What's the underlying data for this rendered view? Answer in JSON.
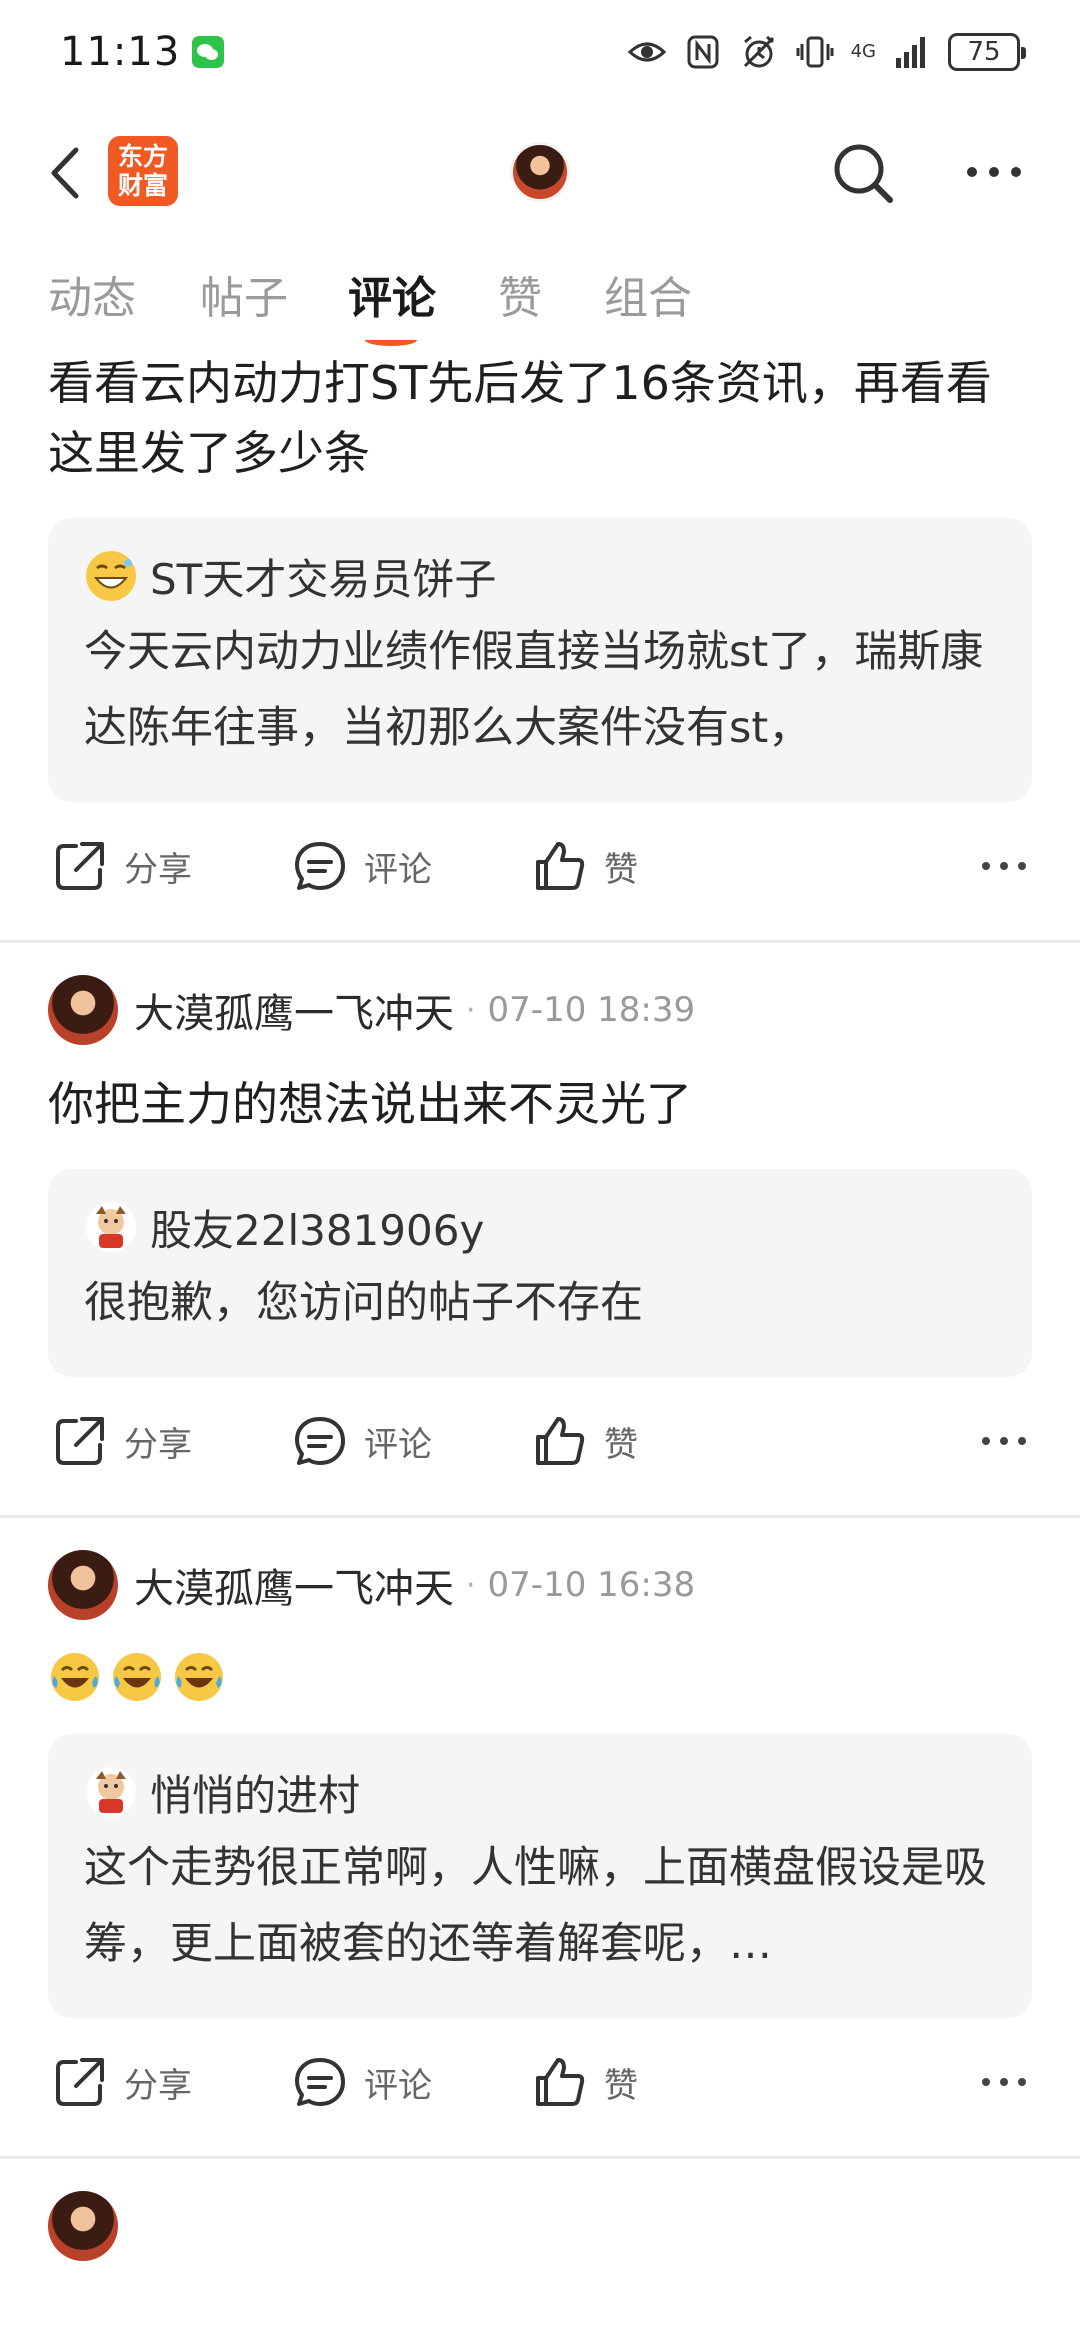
{
  "status_bar": {
    "time": "11:13",
    "network": "4G",
    "battery": "75",
    "icons": [
      "wechat-icon",
      "eye-icon",
      "nfc-icon",
      "alarm-icon",
      "vibrate-icon",
      "signal-icon",
      "battery-icon"
    ]
  },
  "header": {
    "logo_line1": "东方",
    "logo_line2": "财富",
    "icons": [
      "back-icon",
      "search-icon",
      "more-icon"
    ]
  },
  "tabs": [
    {
      "label": "动态"
    },
    {
      "label": "帖子"
    },
    {
      "label": "评论",
      "active": true
    },
    {
      "label": "赞"
    },
    {
      "label": "组合"
    }
  ],
  "colors": {
    "accent": "#f05a22",
    "quote_bg": "#f5f5f5",
    "muted": "#999999"
  },
  "posts": [
    {
      "text": "看看云内动力打ST先后发了16条资讯，再看看这里发了多少条",
      "quote": {
        "name": "ST天才交易员饼子",
        "text": "今天云内动力业绩作假直接当场就st了，瑞斯康达陈年往事，当初那么大案件没有st，"
      }
    },
    {
      "author": "大漠孤鹰一飞冲天",
      "time": "07-10 18:39",
      "text": "你把主力的想法说出来不灵光了",
      "quote": {
        "name": "股友22l381906y",
        "text": "很抱歉，您访问的帖子不存在"
      }
    },
    {
      "author": "大漠孤鹰一飞冲天",
      "time": "07-10 16:38",
      "emojis": [
        "😂",
        "😂",
        "😂"
      ],
      "quote": {
        "name": "悄悄的进村",
        "text": "这个走势很正常啊，人性嘛，上面横盘假设是吸筹，更上面被套的还等着解套呢，…"
      }
    }
  ],
  "actions": {
    "share": "分享",
    "comment": "评论",
    "like": "赞"
  }
}
